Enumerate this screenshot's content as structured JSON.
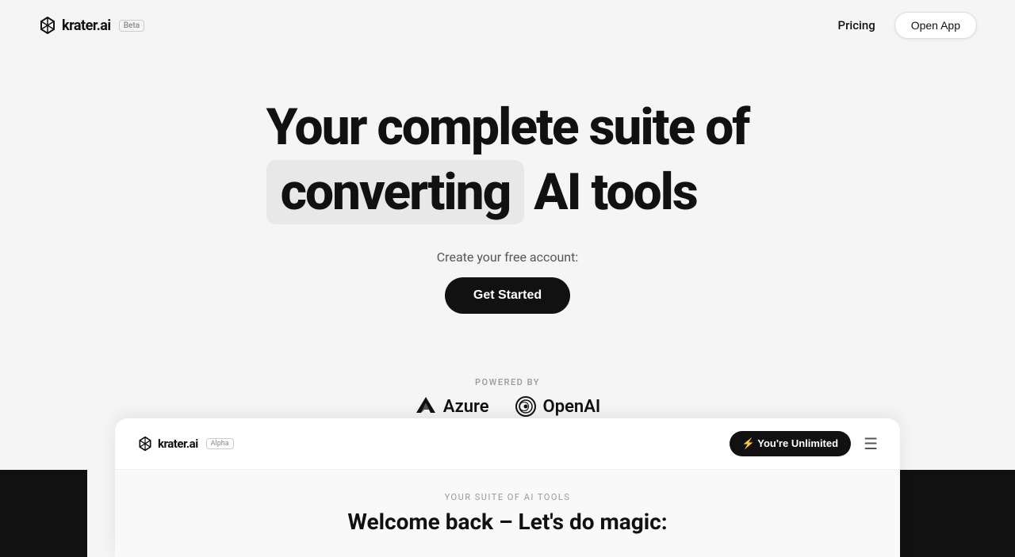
{
  "nav": {
    "logo_text": "krater.ai",
    "beta_label": "Beta",
    "pricing_label": "Pricing",
    "open_app_label": "Open App"
  },
  "hero": {
    "title_line1": "Your complete suite of",
    "title_converting": "converting",
    "title_line2": "AI tools",
    "subtitle": "Create your free account:",
    "cta_label": "Get Started"
  },
  "powered_by": {
    "label": "POWERED BY",
    "azure_label": "Azure",
    "openai_label": "OpenAI"
  },
  "app_preview": {
    "logo_text": "krater.ai",
    "alpha_label": "Alpha",
    "unlimited_label": "⚡ You're Unlimited",
    "suite_label": "YOUR SUITE OF AI TOOLS",
    "welcome_title": "Welcome back – Let's do magic:"
  }
}
